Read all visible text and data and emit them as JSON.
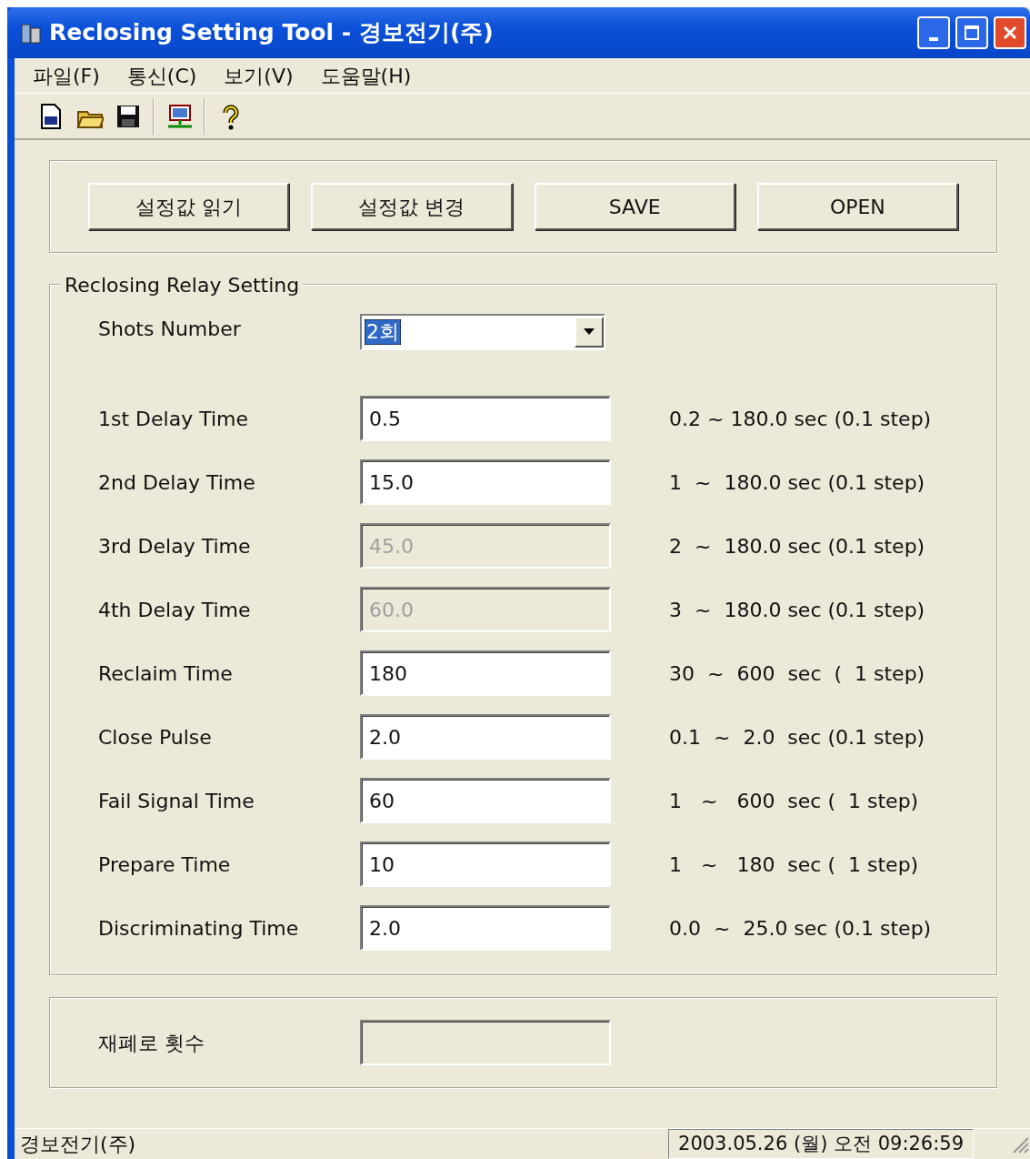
{
  "window": {
    "title": "Reclosing Setting Tool - 경보전기(주)"
  },
  "menu": [
    "파일(F)",
    "통신(C)",
    "보기(V)",
    "도움말(H)"
  ],
  "toolbar": [
    {
      "kind": "new"
    },
    {
      "kind": "open"
    },
    {
      "kind": "save"
    },
    {
      "kind": "sep"
    },
    {
      "kind": "network"
    },
    {
      "kind": "sep"
    },
    {
      "kind": "help"
    }
  ],
  "buttons": [
    "설정값 읽기",
    "설정값 변경",
    "SAVE",
    "OPEN"
  ],
  "relay_group": {
    "title": "Reclosing Relay Setting",
    "shots": {
      "label": "Shots Number",
      "value": "2회"
    },
    "fields": [
      {
        "label": "1st Delay Time",
        "value": "0.5",
        "disabled": false,
        "range": "0.2 ~ 180.0 sec (0.1 step)"
      },
      {
        "label": "2nd Delay Time",
        "value": "15.0",
        "disabled": false,
        "range": "1  ~  180.0 sec (0.1 step)"
      },
      {
        "label": "3rd Delay Time",
        "value": "45.0",
        "disabled": true,
        "range": "2  ~  180.0 sec (0.1 step)"
      },
      {
        "label": "4th Delay Time",
        "value": "60.0",
        "disabled": true,
        "range": "3  ~  180.0 sec (0.1 step)"
      },
      {
        "label": "Reclaim Time",
        "value": "180",
        "disabled": false,
        "range": "30  ~  600  sec  (  1 step)"
      },
      {
        "label": "Close Pulse",
        "value": "2.0",
        "disabled": false,
        "range": "0.1  ~  2.0  sec (0.1 step)"
      },
      {
        "label": "Fail Signal Time",
        "value": "60",
        "disabled": false,
        "range": "1   ~   600  sec (  1 step)"
      },
      {
        "label": "Prepare Time",
        "value": "10",
        "disabled": false,
        "range": "1   ~   180  sec (  1 step)"
      },
      {
        "label": "Discriminating Time",
        "value": "2.0",
        "disabled": false,
        "range": "0.0  ~  25.0 sec (0.1 step)"
      }
    ]
  },
  "count_group": {
    "label": "재폐로 횟수"
  },
  "status_bar": {
    "company": "경보전기(주)",
    "datetime": "2003.05.26 (월) 오전 09:26:59"
  }
}
